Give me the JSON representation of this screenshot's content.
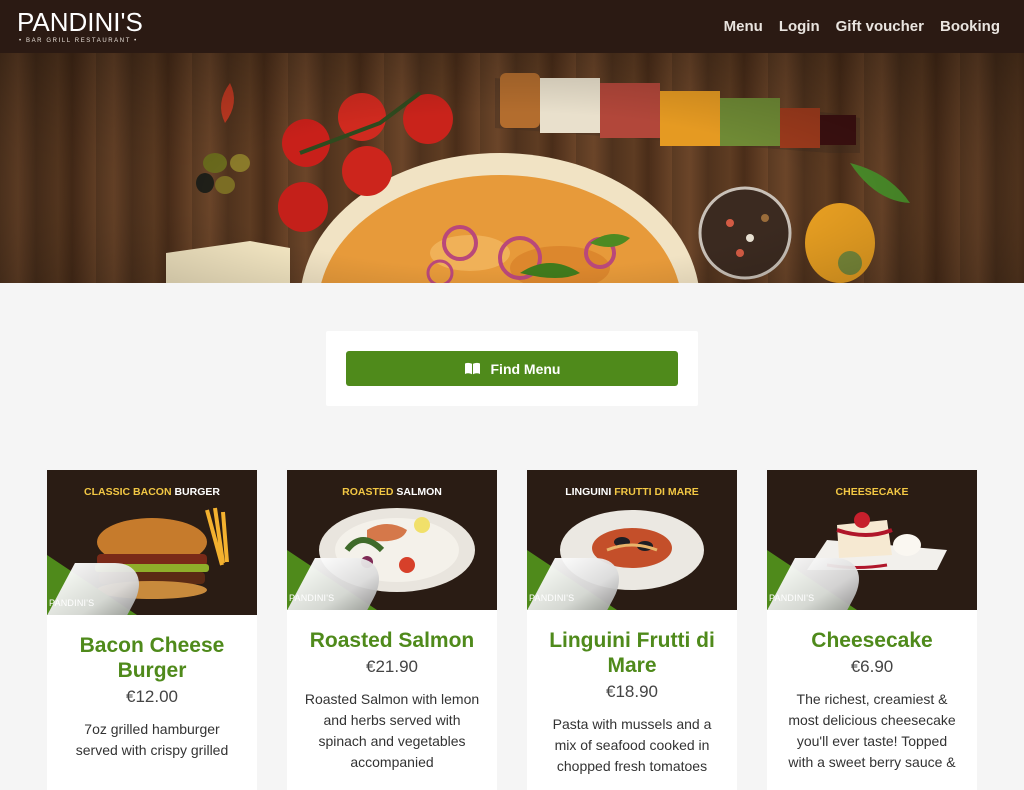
{
  "header": {
    "logo_main": "PANDINI'S",
    "logo_sub": "• BAR  GRILL  RESTAURANT •",
    "nav": [
      "Menu",
      "Login",
      "Gift voucher",
      "Booking"
    ]
  },
  "find_menu": {
    "label": "Find Menu",
    "icon": "book-open-icon"
  },
  "colors": {
    "accent": "#4f8a1b",
    "header_bg": "#2b1a13",
    "page_bg": "#f5f5f5"
  },
  "dishes": [
    {
      "banner_a": "CLASSIC BACON ",
      "banner_b": "BURGER",
      "mini_logo": "PANDINI'S",
      "title": "Bacon Cheese Burger",
      "price": "€12.00",
      "desc": "7oz grilled hamburger served with crispy grilled"
    },
    {
      "banner_a": "ROASTED ",
      "banner_b": "SALMON",
      "mini_logo": "PANDINI'S",
      "title": "Roasted Salmon",
      "price": "€21.90",
      "desc": "Roasted Salmon with lemon and herbs served with spinach and vegetables accompanied"
    },
    {
      "banner_a": "LINGUINI ",
      "banner_b": "FRUTTI DI MARE",
      "mini_logo": "PANDINI'S",
      "title": "Linguini Frutti di Mare",
      "price": "€18.90",
      "desc": "Pasta with mussels and a mix of seafood cooked in chopped fresh tomatoes"
    },
    {
      "banner_a": "CHEESECAKE",
      "banner_b": "",
      "mini_logo": "PANDINI'S",
      "title": "Cheesecake",
      "price": "€6.90",
      "desc": "The richest, creamiest & most delicious cheesecake you'll ever taste! Topped with a sweet berry sauce &"
    }
  ]
}
